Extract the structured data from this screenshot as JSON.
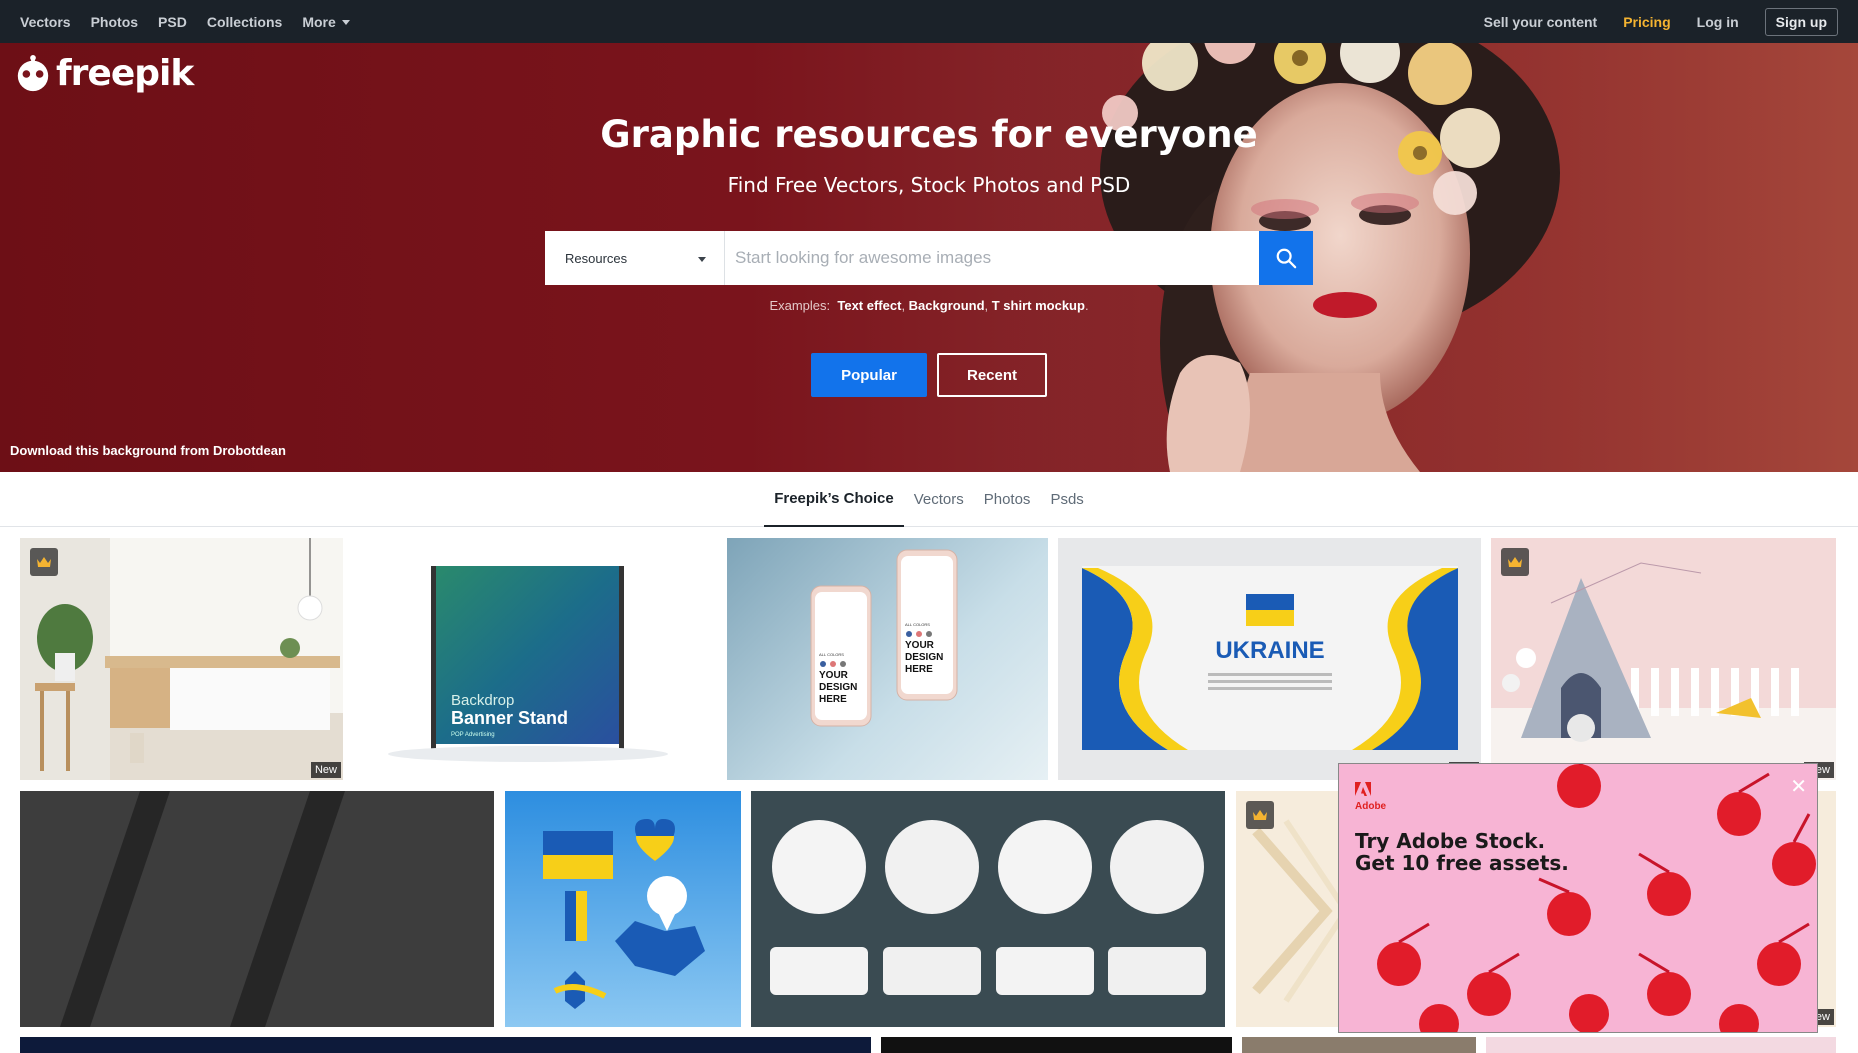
{
  "topnav": {
    "links": [
      "Vectors",
      "Photos",
      "PSD",
      "Collections"
    ],
    "more_label": "More",
    "sell": "Sell your content",
    "pricing": "Pricing",
    "login": "Log in",
    "signup": "Sign up"
  },
  "hero": {
    "logo_text": "freepik",
    "title": "Graphic resources for everyone",
    "subtitle": "Find Free Vectors, Stock Photos and PSD",
    "search": {
      "select_value": "Resources",
      "placeholder": "Start looking for awesome images"
    },
    "examples_label": "Examples:",
    "examples": [
      "Text effect",
      "Background",
      "T shirt mockup"
    ],
    "popular_label": "Popular",
    "recent_label": "Recent",
    "credit": "Download this background from Drobotdean"
  },
  "tabs": [
    "Freepik’s Choice",
    "Vectors",
    "Photos",
    "Psds"
  ],
  "grid": {
    "new_badge": "New",
    "banner_stand": {
      "line1": "Backdrop",
      "line2": "Banner Stand",
      "line3": "POP Advertising"
    },
    "phone_text": {
      "line1": "YOUR",
      "line2": "DESIGN",
      "line3": "HERE",
      "small": "ALL COLORS"
    },
    "ukraine_title": "UKRAINE"
  },
  "ad": {
    "brand": "Adobe",
    "line1": "Try Adobe Stock.",
    "line2": "Get 10 free assets.",
    "close": "✕"
  },
  "colors": {
    "nav_bg": "#1b2229",
    "accent_blue": "#1273eb",
    "pricing": "#f5b431",
    "hero_bg": "#7a141c"
  }
}
